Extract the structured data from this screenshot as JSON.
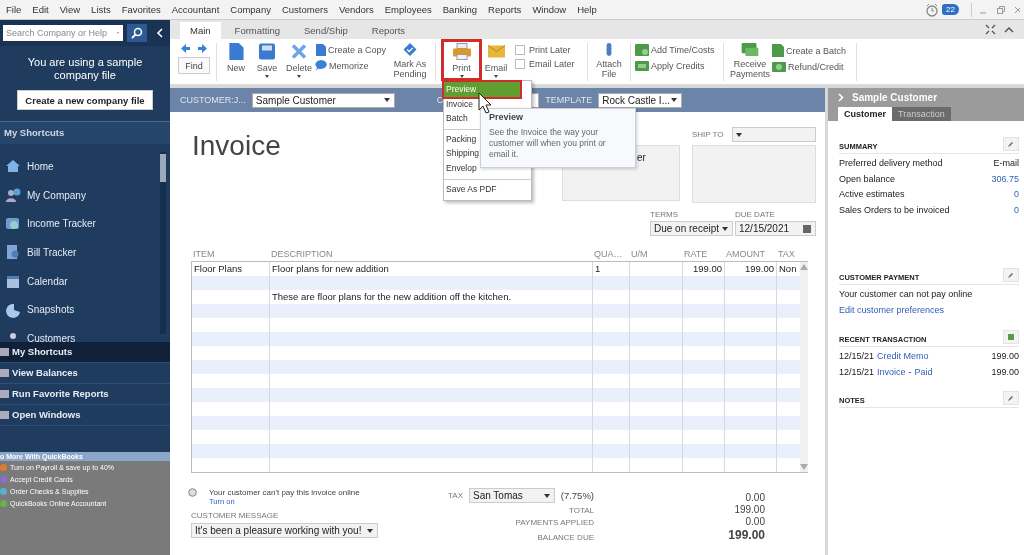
{
  "menu_bar": {
    "items": [
      "File",
      "Edit",
      "View",
      "Lists",
      "Favorites",
      "Accountant",
      "Company",
      "Customers",
      "Vendors",
      "Employees",
      "Banking",
      "Reports",
      "Window",
      "Help"
    ],
    "reminder_count": "22"
  },
  "sidebar": {
    "search": {
      "placeholder": "Search Company or Help"
    },
    "notice": "You are using a sample company file",
    "create_button": "Create a new company file",
    "shortcuts_title": "My Shortcuts",
    "shortcuts": [
      {
        "label": "Home"
      },
      {
        "label": "My Company"
      },
      {
        "label": "Income Tracker"
      },
      {
        "label": "Bill Tracker"
      },
      {
        "label": "Calendar"
      },
      {
        "label": "Snapshots"
      },
      {
        "label": "Customers"
      }
    ],
    "sections": [
      {
        "label": "My Shortcuts",
        "selected": true
      },
      {
        "label": "View Balances",
        "selected": false
      },
      {
        "label": "Run Favorite Reports",
        "selected": false
      },
      {
        "label": "Open Windows",
        "selected": false
      }
    ],
    "promo": {
      "title": "o More With QuickBooks",
      "items": [
        {
          "label": "Turn on Payroll & save up to 40%",
          "color": "#e07b2e"
        },
        {
          "label": "Accept Credit Cards",
          "color": "#8a6fc8"
        },
        {
          "label": "Order Checks & Supplies",
          "color": "#5ab0d0"
        },
        {
          "label": "QuickBooks Online Accountant",
          "color": "#6ab04c"
        }
      ]
    }
  },
  "ribbon": {
    "tabs": [
      {
        "label": "Main",
        "selected": true
      },
      {
        "label": "Formatting",
        "selected": false
      },
      {
        "label": "Send/Ship",
        "selected": false
      },
      {
        "label": "Reports",
        "selected": false
      }
    ],
    "find": "Find",
    "new": "New",
    "save": "Save",
    "delete": "Delete",
    "create_copy": "Create a Copy",
    "memorize": "Memorize",
    "mark_pending": "Mark As Pending",
    "print": {
      "label": "Print",
      "highlighted": true
    },
    "email": "Email",
    "print_later": {
      "label": "Print Later",
      "checked": false
    },
    "email_later": {
      "label": "Email Later",
      "checked": false
    },
    "attach": "Attach File",
    "add_time": "Add Time/Costs",
    "apply_credits": "Apply Credits",
    "receive": "Receive Payments",
    "create_batch": "Create a Batch",
    "refund": "Refund/Credit"
  },
  "print_menu": {
    "items": [
      {
        "label": "Preview",
        "selected": true,
        "divider_before": false
      },
      {
        "label": "Invoice",
        "selected": false,
        "divider_before": false
      },
      {
        "label": "Batch",
        "selected": false,
        "divider_before": false
      },
      {
        "label": "Packing",
        "selected": false,
        "divider_before": true
      },
      {
        "label": "Shipping",
        "selected": false,
        "divider_before": false
      },
      {
        "label": "Envelop",
        "selected": false,
        "divider_before": false
      },
      {
        "label": "Save As PDF",
        "selected": false,
        "divider_before": true
      }
    ]
  },
  "tooltip": {
    "title": "Preview",
    "text": "See the Invoice the way your customer will when you print or email it."
  },
  "invoice": {
    "customer_label": "CUSTOMER:J...",
    "customer": "Sample Customer",
    "class_label": "C",
    "template_label": "TEMPLATE",
    "template": "Rock Castle I...",
    "title": "Invoice",
    "bill_to": "er",
    "ship_to_label": "SHIP TO",
    "terms_label": "TERMS",
    "terms": "Due on receipt",
    "due_date_label": "DUE DATE",
    "due_date": "12/15/2021",
    "table": {
      "columns": [
        "ITEM",
        "DESCRIPTION",
        "QUA…",
        "U/M",
        "RATE",
        "AMOUNT",
        "TAX"
      ],
      "rows": [
        {
          "kind": "item",
          "item": "Floor Plans",
          "description": "Floor plans for new addition",
          "quantity": "1",
          "rate": "199.00",
          "amount": "199.00",
          "tax": "Non"
        },
        {
          "kind": "blank"
        },
        {
          "kind": "note",
          "description": "These are floor plans for the new addition off the kitchen."
        }
      ]
    },
    "online_notice": "Your customer can't pay this invoice online",
    "turn_on": "Turn on",
    "message_label": "CUSTOMER MESSAGE",
    "message": "It's been a pleasure working with you!",
    "tax_label": "TAX",
    "tax_code": "San Tomas",
    "tax_rate": "(7.75%)",
    "tax_amount": "0.00",
    "total_label": "TOTAL",
    "total": "199.00",
    "payments_label": "PAYMENTS APPLIED",
    "payments": "0.00",
    "balance_label": "BALANCE DUE",
    "balance": "199.00"
  },
  "customer_panel": {
    "title": "Sample Customer",
    "tabs": [
      {
        "label": "Customer",
        "selected": true
      },
      {
        "label": "Transaction",
        "selected": false
      }
    ],
    "summary": {
      "title": "SUMMARY",
      "rows": [
        {
          "label": "Preferred delivery method",
          "value": "E-mail",
          "link": false
        },
        {
          "label": "Open balance",
          "value": "306.75",
          "link": true
        },
        {
          "label": "Active estimates",
          "value": "0",
          "link": true
        },
        {
          "label": "Sales Orders to be invoiced",
          "value": "0",
          "link": true
        }
      ]
    },
    "payment": {
      "title": "CUSTOMER PAYMENT",
      "text": "Your customer can not pay online",
      "link": "Edit customer preferences"
    },
    "recent": {
      "title": "RECENT TRANSACTION",
      "rows": [
        {
          "date": "12/15/21",
          "type": "Credit Memo",
          "amount": "199.00"
        },
        {
          "date": "12/15/21",
          "type": "Invoice",
          "joiner": "-",
          "status": "Paid",
          "amount": "199.00"
        }
      ]
    },
    "notes": {
      "title": "NOTES"
    }
  }
}
